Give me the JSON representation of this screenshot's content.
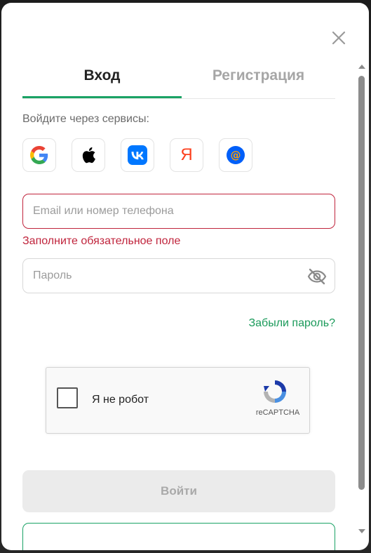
{
  "tabs": {
    "login": "Вход",
    "register": "Регистрация"
  },
  "services": {
    "label": "Войдите через сервисы:",
    "items": [
      {
        "name": "google",
        "icon": "google-icon"
      },
      {
        "name": "apple",
        "icon": "apple-icon"
      },
      {
        "name": "vk",
        "icon": "vk-icon",
        "glyph": "VK"
      },
      {
        "name": "yandex",
        "icon": "yandex-icon",
        "glyph": "Я"
      },
      {
        "name": "mailru",
        "icon": "mailru-icon",
        "glyph": "@"
      }
    ]
  },
  "form": {
    "email_placeholder": "Email или номер телефона",
    "email_value": "",
    "email_error": "Заполните обязательное поле",
    "password_placeholder": "Пароль",
    "password_value": "",
    "forgot_password": "Забыли пароль?"
  },
  "recaptcha": {
    "label": "Я не робот",
    "brand": "reCAPTCHA"
  },
  "actions": {
    "submit": "Войти"
  },
  "colors": {
    "accent": "#1aa265",
    "error": "#c0243c",
    "vk": "#0077ff",
    "yandex": "#fc3f1d",
    "mailru": "#005ff9"
  }
}
